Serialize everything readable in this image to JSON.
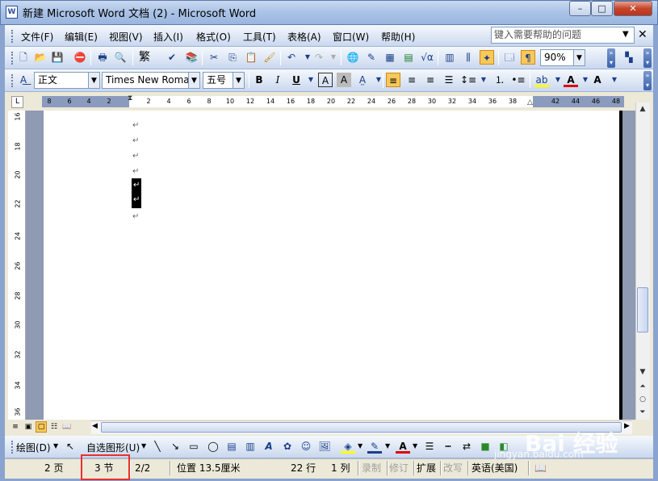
{
  "window": {
    "title": "新建 Microsoft Word 文档 (2) - Microsoft Word",
    "app_icon": "W",
    "minimize": "–",
    "maximize": "□",
    "close": "✕"
  },
  "menu": {
    "items": [
      "文件(F)",
      "编辑(E)",
      "视图(V)",
      "插入(I)",
      "格式(O)",
      "工具(T)",
      "表格(A)",
      "窗口(W)",
      "帮助(H)"
    ],
    "help_placeholder": "键入需要帮助的问题",
    "doc_close": "✕"
  },
  "standard_toolbar": {
    "zoom": "90%",
    "trad_chinese": "繁"
  },
  "format_toolbar": {
    "style": "正文",
    "font": "Times New Roman",
    "size": "五号",
    "bold": "B",
    "italic": "I",
    "underline": "U",
    "char_border": "A",
    "char_shading": "A",
    "font_color": "A",
    "grow_font": "A"
  },
  "ruler": {
    "corner": "L",
    "labels_left": [
      "8",
      "6",
      "4",
      "2"
    ],
    "labels_right": [
      "2",
      "4",
      "6",
      "8",
      "10",
      "12",
      "14",
      "16",
      "18",
      "20",
      "22",
      "24",
      "26",
      "28",
      "30",
      "32",
      "34",
      "36",
      "38"
    ],
    "labels_far": [
      "42",
      "44",
      "46",
      "48"
    ]
  },
  "vruler": {
    "labels": [
      "16",
      "18",
      "20",
      "22",
      "24",
      "26",
      "28",
      "30",
      "32",
      "34",
      "36"
    ]
  },
  "document": {
    "para_mark": "↵"
  },
  "draw_toolbar": {
    "draw": "绘图(D)",
    "autoshapes": "自选图形(U)"
  },
  "status": {
    "page": "2 页",
    "section": "3 节",
    "page_of": "2/2",
    "position": "位置 13.5厘米",
    "line": "22 行",
    "column": "1 列",
    "rec": "录制",
    "trk": "修订",
    "ext": "扩展",
    "ovr": "改写",
    "language": "英语(美国)"
  },
  "watermark": {
    "brand": "Bai 经验",
    "url": "jingyan.baidu.com"
  },
  "colors": {
    "highlight_box": "#e8312f",
    "toolbar_bg": "#dbe5f4",
    "font_color_red": "#e00000",
    "highlight_yellow": "#ffff00"
  }
}
